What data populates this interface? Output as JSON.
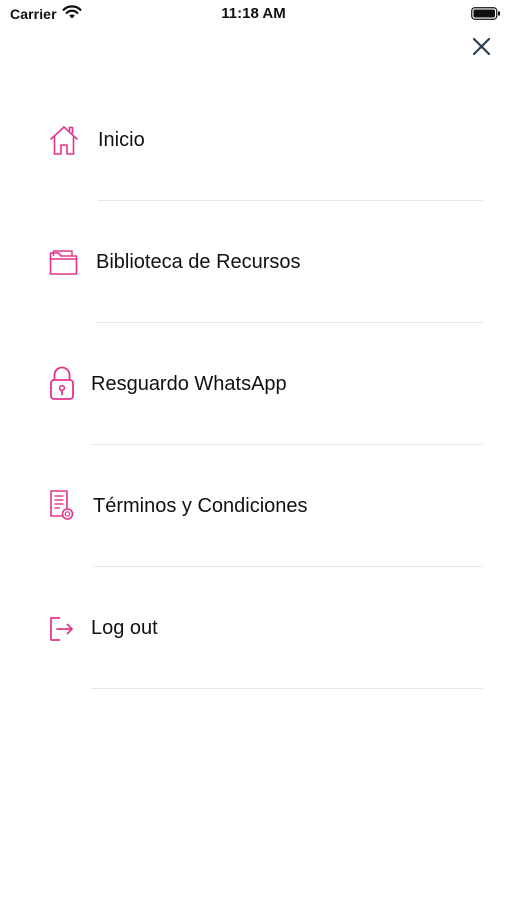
{
  "status_bar": {
    "carrier": "Carrier",
    "time": "11:18 AM"
  },
  "theme": {
    "accent": "#e5338c",
    "text": "#111111",
    "divider": "#e6e6e6",
    "close_icon_color": "#2c3e50"
  },
  "menu": {
    "items": [
      {
        "label": "Inicio",
        "icon": "home-icon"
      },
      {
        "label": "Biblioteca de Recursos",
        "icon": "folder-icon"
      },
      {
        "label": "Resguardo WhatsApp",
        "icon": "lock-icon"
      },
      {
        "label": "Términos y Condiciones",
        "icon": "document-icon"
      },
      {
        "label": "Log out",
        "icon": "logout-icon"
      }
    ]
  }
}
